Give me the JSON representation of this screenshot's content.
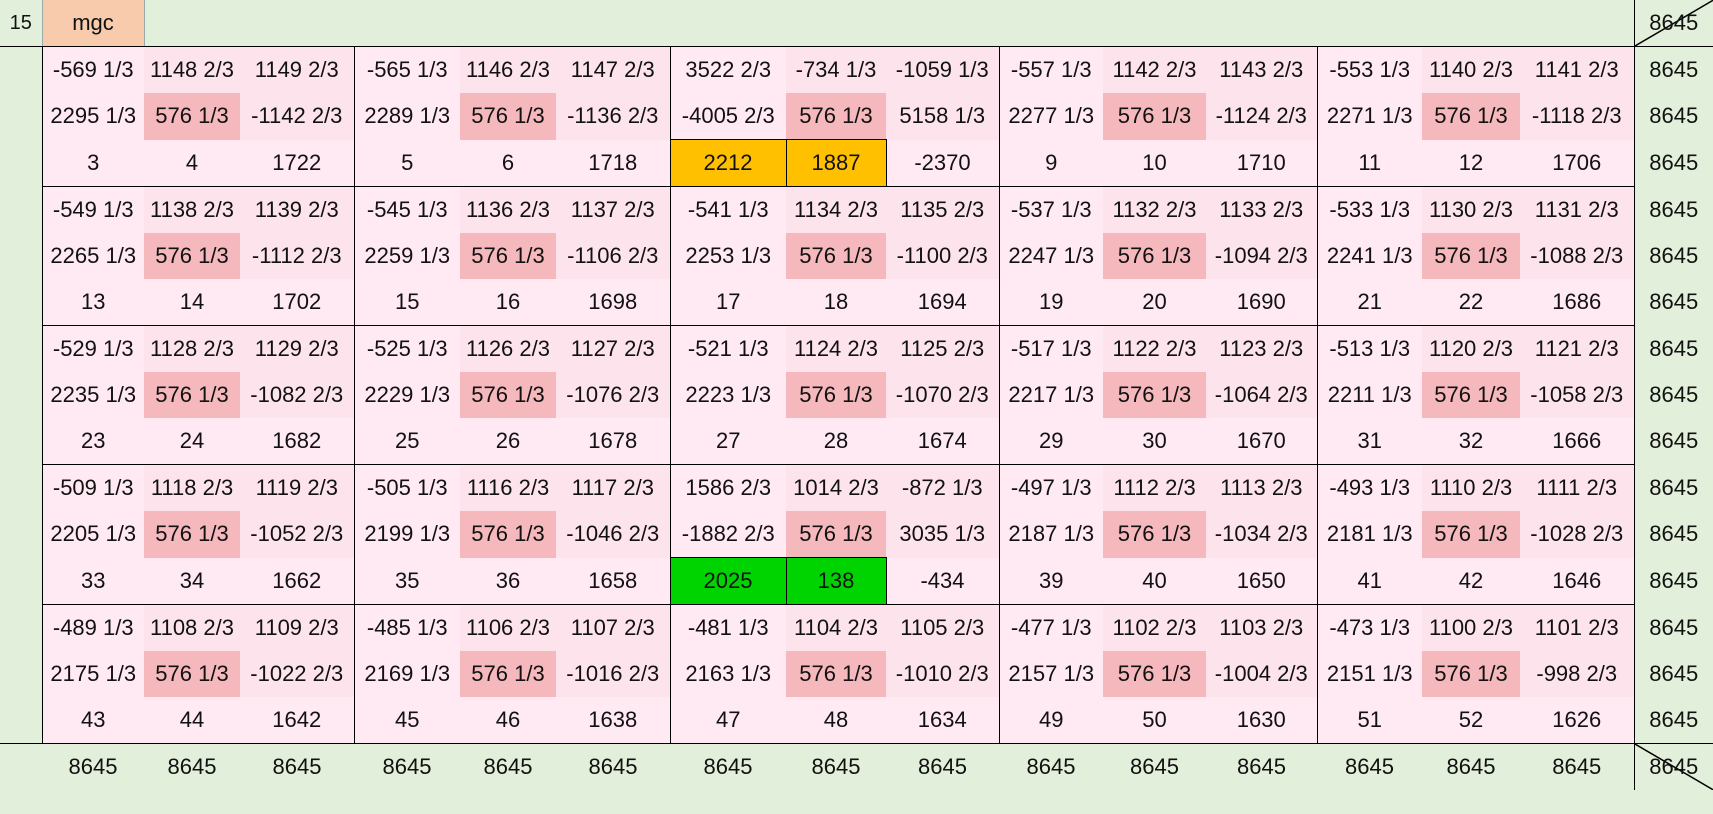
{
  "sheet": {
    "row_index": "15",
    "label": "mgc",
    "constant": "8645",
    "colors": {
      "background": "#e2efda",
      "cell_pink": "#fde4ec",
      "cell_light": "#ffe9f2",
      "cell_highlight": "#f4b8bd",
      "label_bg": "#f8cbad",
      "orange": "#ffc000",
      "green": "#00d400"
    },
    "grid": [
      [
        "-569 1/3",
        "1148 2/3",
        "1149 2/3",
        "-565 1/3",
        "1146 2/3",
        "1147 2/3",
        "3522 2/3",
        "-734 1/3",
        "-1059 1/3",
        "-557 1/3",
        "1142 2/3",
        "1143 2/3",
        "-553 1/3",
        "1140 2/3",
        "1141 2/3"
      ],
      [
        "2295 1/3",
        "576 1/3",
        "-1142 2/3",
        "2289 1/3",
        "576 1/3",
        "-1136 2/3",
        "-4005 2/3",
        "576 1/3",
        "5158 1/3",
        "2277 1/3",
        "576 1/3",
        "-1124 2/3",
        "2271 1/3",
        "576 1/3",
        "-1118 2/3"
      ],
      [
        "3",
        "4",
        "1722",
        "5",
        "6",
        "1718",
        "2212",
        "1887",
        "-2370",
        "9",
        "10",
        "1710",
        "11",
        "12",
        "1706"
      ],
      [
        "-549 1/3",
        "1138 2/3",
        "1139 2/3",
        "-545 1/3",
        "1136 2/3",
        "1137 2/3",
        "-541 1/3",
        "1134 2/3",
        "1135 2/3",
        "-537 1/3",
        "1132 2/3",
        "1133 2/3",
        "-533 1/3",
        "1130 2/3",
        "1131 2/3"
      ],
      [
        "2265 1/3",
        "576 1/3",
        "-1112 2/3",
        "2259 1/3",
        "576 1/3",
        "-1106 2/3",
        "2253 1/3",
        "576 1/3",
        "-1100 2/3",
        "2247 1/3",
        "576 1/3",
        "-1094 2/3",
        "2241 1/3",
        "576 1/3",
        "-1088 2/3"
      ],
      [
        "13",
        "14",
        "1702",
        "15",
        "16",
        "1698",
        "17",
        "18",
        "1694",
        "19",
        "20",
        "1690",
        "21",
        "22",
        "1686"
      ],
      [
        "-529 1/3",
        "1128 2/3",
        "1129 2/3",
        "-525 1/3",
        "1126 2/3",
        "1127 2/3",
        "-521 1/3",
        "1124 2/3",
        "1125 2/3",
        "-517 1/3",
        "1122 2/3",
        "1123 2/3",
        "-513 1/3",
        "1120 2/3",
        "1121 2/3"
      ],
      [
        "2235 1/3",
        "576 1/3",
        "-1082 2/3",
        "2229 1/3",
        "576 1/3",
        "-1076 2/3",
        "2223 1/3",
        "576 1/3",
        "-1070 2/3",
        "2217 1/3",
        "576 1/3",
        "-1064 2/3",
        "2211 1/3",
        "576 1/3",
        "-1058 2/3"
      ],
      [
        "23",
        "24",
        "1682",
        "25",
        "26",
        "1678",
        "27",
        "28",
        "1674",
        "29",
        "30",
        "1670",
        "31",
        "32",
        "1666"
      ],
      [
        "-509 1/3",
        "1118 2/3",
        "1119 2/3",
        "-505 1/3",
        "1116 2/3",
        "1117 2/3",
        "1586 2/3",
        "1014 2/3",
        "-872 1/3",
        "-497 1/3",
        "1112 2/3",
        "1113 2/3",
        "-493 1/3",
        "1110 2/3",
        "1111 2/3"
      ],
      [
        "2205 1/3",
        "576 1/3",
        "-1052 2/3",
        "2199 1/3",
        "576 1/3",
        "-1046 2/3",
        "-1882 2/3",
        "576 1/3",
        "3035 1/3",
        "2187 1/3",
        "576 1/3",
        "-1034 2/3",
        "2181 1/3",
        "576 1/3",
        "-1028 2/3"
      ],
      [
        "33",
        "34",
        "1662",
        "35",
        "36",
        "1658",
        "2025",
        "138",
        "-434",
        "39",
        "40",
        "1650",
        "41",
        "42",
        "1646"
      ],
      [
        "-489 1/3",
        "1108 2/3",
        "1109 2/3",
        "-485 1/3",
        "1106 2/3",
        "1107 2/3",
        "-481 1/3",
        "1104 2/3",
        "1105 2/3",
        "-477 1/3",
        "1102 2/3",
        "1103 2/3",
        "-473 1/3",
        "1100 2/3",
        "1101 2/3"
      ],
      [
        "2175 1/3",
        "576 1/3",
        "-1022 2/3",
        "2169 1/3",
        "576 1/3",
        "-1016 2/3",
        "2163 1/3",
        "576 1/3",
        "-1010 2/3",
        "2157 1/3",
        "576 1/3",
        "-1004 2/3",
        "2151 1/3",
        "576 1/3",
        "-998 2/3"
      ],
      [
        "43",
        "44",
        "1642",
        "45",
        "46",
        "1638",
        "47",
        "48",
        "1634",
        "49",
        "50",
        "1630",
        "51",
        "52",
        "1626"
      ]
    ],
    "highlights": {
      "orange_cells": [
        [
          2,
          6
        ],
        [
          2,
          7
        ]
      ],
      "green_cells": [
        [
          11,
          6
        ],
        [
          11,
          7
        ]
      ]
    }
  }
}
